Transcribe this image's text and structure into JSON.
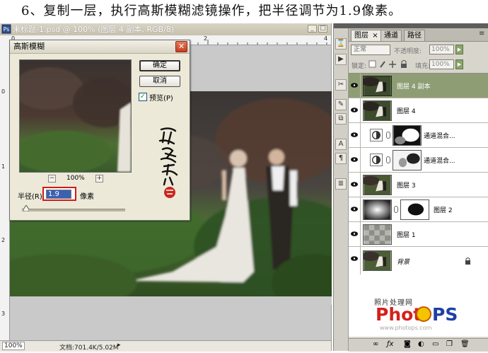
{
  "instruction": "6、复制一层，执行高斯模糊滤镜操作，把半径调节为1.9像素。",
  "document": {
    "title": "未标题-1.psd @ 100% (图层 4 副本, RGB/8)",
    "zoom": "100%",
    "doc_size": "文档:701.4K/5.02M",
    "ruler_top": [
      "0",
      "2",
      "4"
    ],
    "ruler_left": [
      "0",
      "1",
      "2",
      "3"
    ]
  },
  "dialog": {
    "title": "高斯模糊",
    "ok_label": "确定",
    "cancel_label": "取消",
    "preview_label": "预览(P)",
    "preview_checked": true,
    "zoom_label": "100%",
    "zoom_out": "−",
    "zoom_in": "+",
    "radius_label": "半径(R):",
    "radius_value": "1.9",
    "radius_unit": "像素",
    "slider_value_fraction": 0.02
  },
  "panel": {
    "tabs": [
      {
        "label": "图层",
        "close": "×",
        "active": true
      },
      {
        "label": "通道",
        "active": false
      },
      {
        "label": "路径",
        "active": false
      }
    ],
    "blend_mode": "正常",
    "opacity_label": "不透明度:",
    "opacity_value": "100%",
    "lock_label": "锁定:",
    "fill_label": "填充:",
    "fill_value": "100%",
    "layers": [
      {
        "name": "图层 4 副本",
        "selected": true,
        "thumb": "photo"
      },
      {
        "name": "图层 4",
        "selected": false,
        "thumb": "photo"
      },
      {
        "name": "通道混合...",
        "selected": false,
        "thumb": "mask-adj"
      },
      {
        "name": "通道混合...",
        "selected": false,
        "thumb": "mask-adj"
      },
      {
        "name": "图层 3",
        "selected": false,
        "thumb": "photo"
      },
      {
        "name": "图层 2",
        "selected": false,
        "thumb": "radial"
      },
      {
        "name": "图层 1",
        "selected": false,
        "thumb": "texture"
      },
      {
        "name": "背景",
        "selected": false,
        "thumb": "photo",
        "italic": true,
        "locked": true
      }
    ],
    "toolstrip_icons": [
      "history-icon",
      "actions-icon",
      "tool-presets-icon",
      "brushes-icon",
      "clone-source-icon",
      "character-icon",
      "paragraph-icon",
      "layer-comps-icon"
    ],
    "bottom_icons": [
      "link-layers-icon",
      "fx-icon",
      "add-mask-icon",
      "adjustment-icon",
      "group-icon",
      "new-layer-icon",
      "trash-icon"
    ]
  },
  "watermark": {
    "subtitle": "照片处理网",
    "logo": "PhotoPS",
    "url": "www.photops.com"
  },
  "colors": {
    "selected_layer": "#8f9d75",
    "highlight_box": "#d01a1a",
    "dialog_bg": "#ece9d8"
  }
}
